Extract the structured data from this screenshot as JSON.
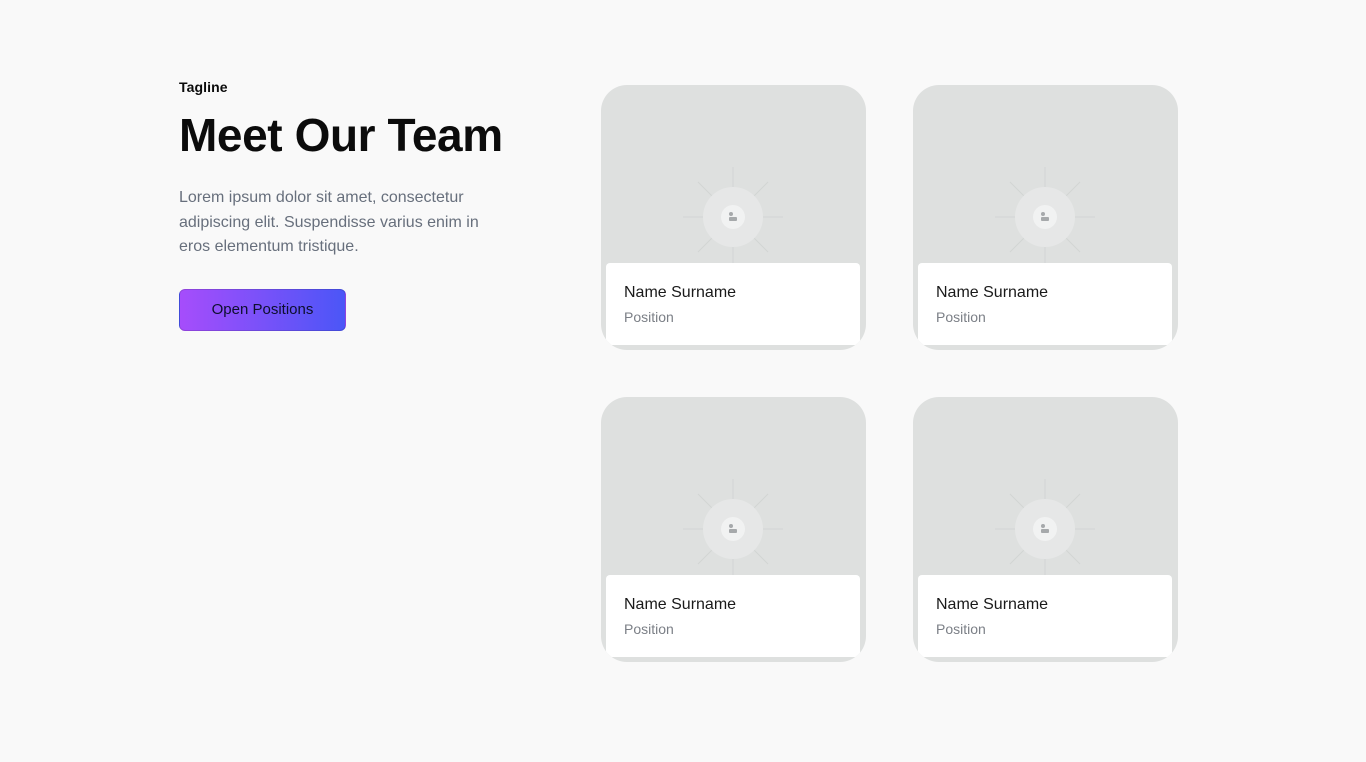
{
  "hero": {
    "tagline": "Tagline",
    "title": "Meet Our Team",
    "description": "Lorem ipsum dolor sit amet, consectetur adipiscing elit. Suspendisse varius enim in eros elementum tristique.",
    "cta_label": "Open Positions"
  },
  "team": [
    {
      "name": "Name Surname",
      "position": "Position",
      "photo_icon": "image-placeholder-icon"
    },
    {
      "name": "Name Surname",
      "position": "Position",
      "photo_icon": "image-placeholder-icon"
    },
    {
      "name": "Name Surname",
      "position": "Position",
      "photo_icon": "image-placeholder-icon"
    },
    {
      "name": "Name Surname",
      "position": "Position",
      "photo_icon": "image-placeholder-icon"
    }
  ],
  "colors": {
    "background": "#f9f9f9",
    "card_photo_bg": "#dee0df",
    "cta_gradient_start": "#a64dfb",
    "cta_gradient_end": "#4b56f7",
    "muted_text": "#676f7c"
  }
}
